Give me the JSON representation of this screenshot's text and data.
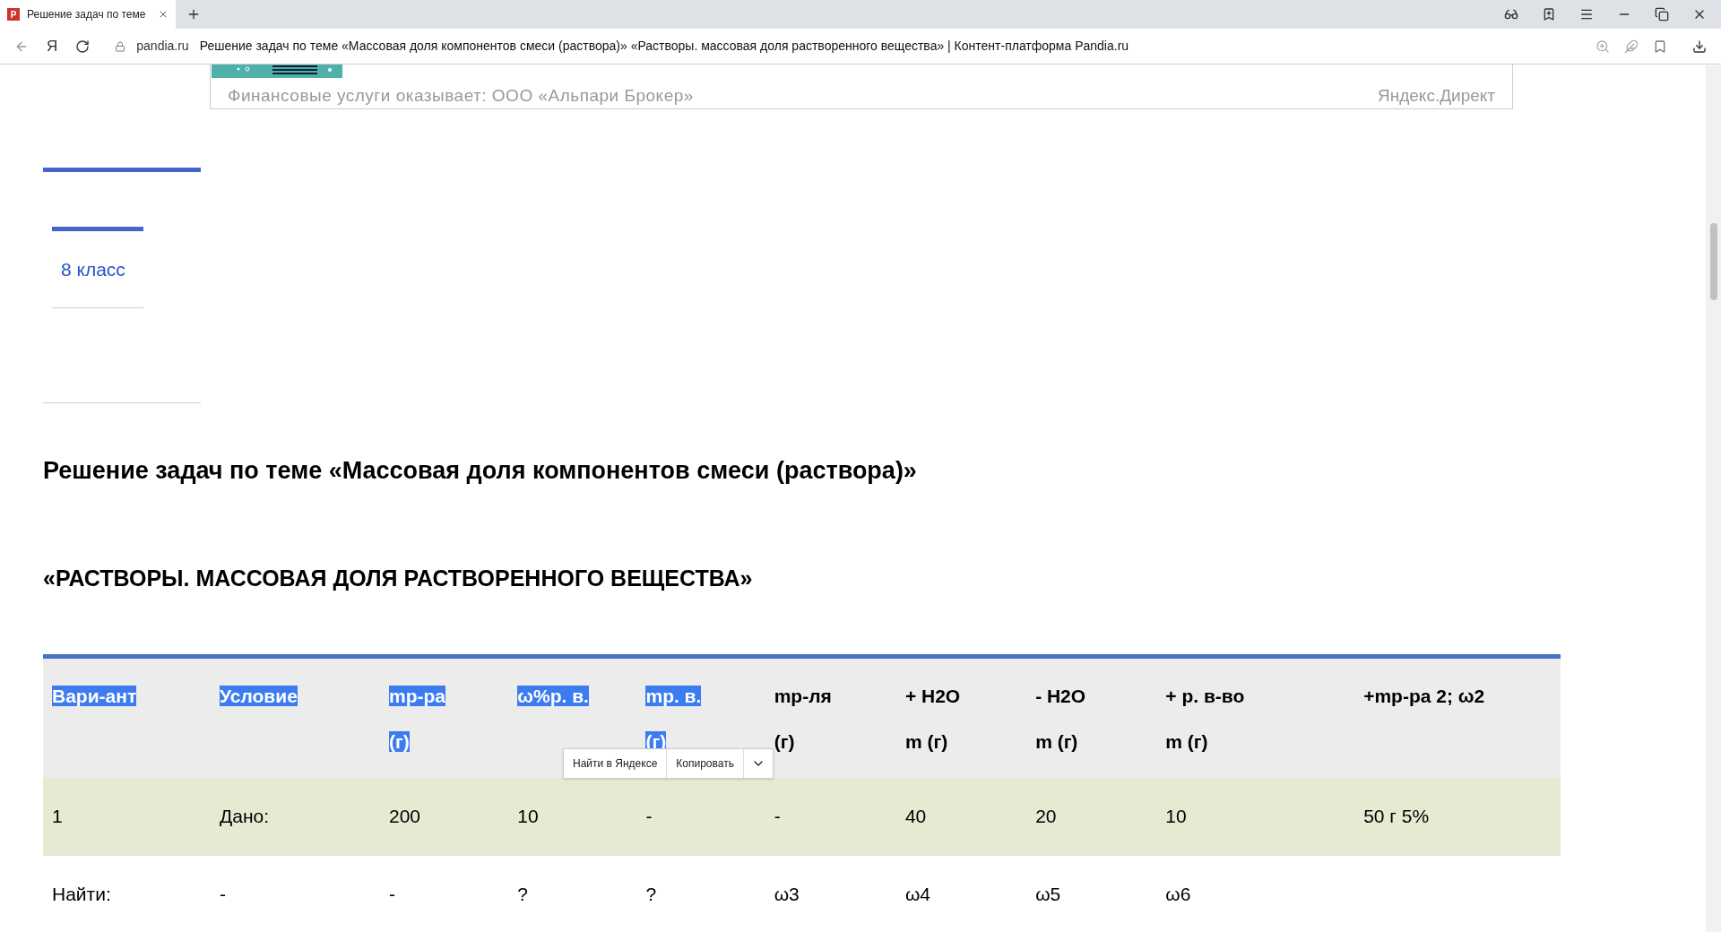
{
  "browser": {
    "tab": {
      "favicon": "P",
      "title": "Решение задач по теме"
    },
    "home_logo": "Я",
    "address": {
      "domain": "pandia.ru",
      "page_title": "Решение задач по теме «Массовая доля компонентов смеси (раствора)» «Растворы. массовая доля растворенного вещества» | Контент-платформа Pandia.ru"
    }
  },
  "ad": {
    "text": "Финансовые услуги оказывает: ООО «Альпари Брокер»",
    "source": "Яндекс.Директ"
  },
  "sidebar": {
    "link": "8 класс"
  },
  "heading": "Решение задач по теме «Массовая доля компонентов смеси (раствора)»",
  "subheading": "«РАСТВОРЫ. МАССОВАЯ ДОЛЯ РАСТВОРЕННОГО ВЕЩЕСТВА»",
  "table": {
    "columns": [
      {
        "lines": [
          {
            "text": "Вари-ант",
            "highlighted": true
          }
        ]
      },
      {
        "lines": [
          {
            "text": "Условие",
            "highlighted": true
          }
        ]
      },
      {
        "lines": [
          {
            "text": "mр-ра",
            "highlighted": true
          },
          {
            "text": "(г)",
            "highlighted": true
          }
        ]
      },
      {
        "lines": [
          {
            "text": "ω%р. в.",
            "highlighted": true
          }
        ]
      },
      {
        "lines": [
          {
            "text": "mр. в.",
            "highlighted": true
          },
          {
            "text": "(г)",
            "highlighted": true
          }
        ]
      },
      {
        "lines": [
          {
            "text": "mр-ля",
            "highlighted": false
          },
          {
            "text": "(г)",
            "highlighted": false
          }
        ]
      },
      {
        "lines": [
          {
            "text": "+ H2O",
            "highlighted": false
          },
          {
            "text": "m (г)",
            "highlighted": false
          }
        ]
      },
      {
        "lines": [
          {
            "text": "- H2O",
            "highlighted": false
          },
          {
            "text": "m (г)",
            "highlighted": false
          }
        ]
      },
      {
        "lines": [
          {
            "text": "+ р. в-во",
            "highlighted": false
          },
          {
            "text": "m (г)",
            "highlighted": false
          }
        ]
      },
      {
        "lines": [
          {
            "text": "+mр-ра 2; ω2",
            "highlighted": false
          }
        ]
      }
    ],
    "rows": [
      {
        "shaded": true,
        "cells": [
          "1",
          "Дано:",
          "200",
          "10",
          "-",
          "-",
          "40",
          "20",
          "10",
          "50 г 5%"
        ]
      },
      {
        "shaded": false,
        "cells": [
          "Найти:",
          "-",
          "-",
          "?",
          "?",
          "ω3",
          "ω4",
          "ω5",
          "ω6",
          ""
        ]
      }
    ]
  },
  "selection_popup": {
    "items": [
      "Найти в Яндексе",
      "Копировать"
    ]
  }
}
